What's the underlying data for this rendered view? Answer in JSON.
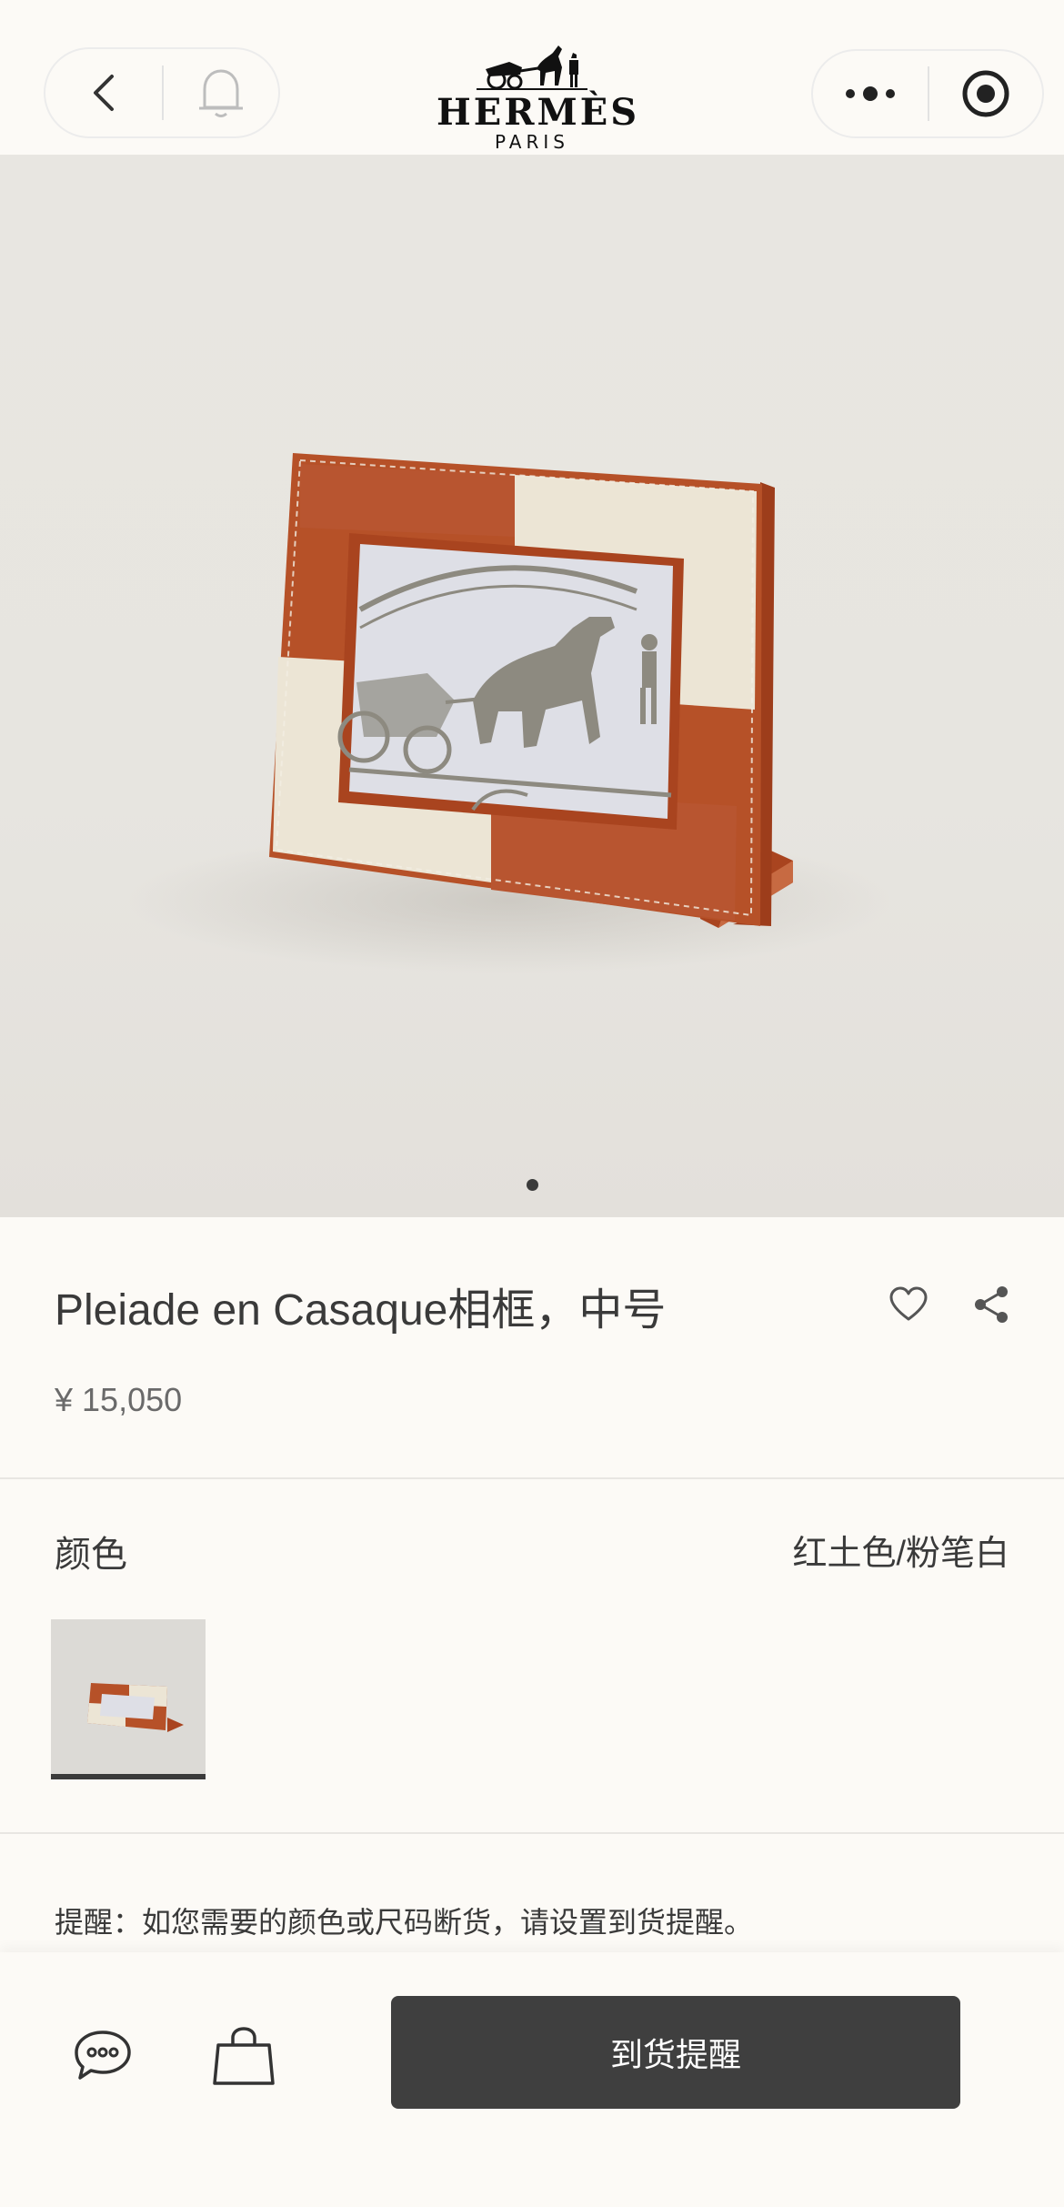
{
  "header": {
    "back_icon": "chevron-left-icon",
    "bell_icon": "bell-icon",
    "more_icon": "more-dots-icon",
    "target_icon": "target-icon",
    "logo_brand": "HERMÈS",
    "logo_city": "PARIS"
  },
  "hero": {
    "pagination_count": 1,
    "active_index": 0
  },
  "product": {
    "title": "Pleiade en Casaque相框，中号",
    "price": "¥ 15,050",
    "color_label": "颜色",
    "color_value": "红土色/粉笔白",
    "notice": "提醒：如您需要的颜色或尺码断货，请设置到货提醒。"
  },
  "bottom_bar": {
    "chat_icon": "chat-bubble-icon",
    "bag_icon": "shopping-bag-icon",
    "cta_label": "到货提醒"
  },
  "colors": {
    "background": "#fcfaf6",
    "cta": "#3f3f3f",
    "leather_orange": "#b8532c",
    "leather_chalk": "#ece5d6"
  }
}
